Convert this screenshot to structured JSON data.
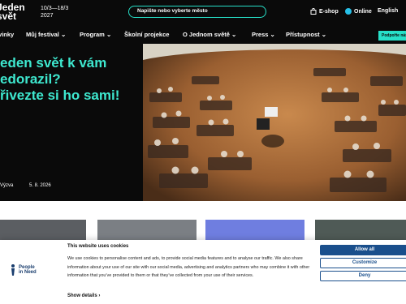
{
  "header": {
    "logo": [
      "Jeden",
      "svět"
    ],
    "dates": [
      "10/3—18/3",
      "2027"
    ],
    "search_placeholder": "Napište nebo vyberte město",
    "links": [
      {
        "label": "E-shop",
        "icon": "bag-icon"
      },
      {
        "label": "Online",
        "icon": "play-icon"
      },
      {
        "label": "English"
      }
    ]
  },
  "nav": {
    "items": [
      "vinky",
      "Můj festival",
      "Program",
      "Školní projekce",
      "O Jednom světě",
      "Press",
      "Přístupnost"
    ],
    "support_label": "Podpořte nás"
  },
  "hero": {
    "lines": [
      "eden svět k vám",
      "edorazil?",
      "řivezte si ho sami!"
    ],
    "meta_label": "Výzva",
    "meta_date": "5. 8. 2026"
  },
  "cookie": {
    "title": "This website uses cookies",
    "text": "We use cookies to personalise content and ads, to provide social media features and to analyse our traffic. We also share information about your use of our site with our social media, advertising and analytics partners who may combine it with other information that you’ve provided to them or that they’ve collected from your use of their services.",
    "show_details": "Show details",
    "buttons": {
      "allow_all": "Allow all",
      "customize": "Customize",
      "deny": "Deny"
    },
    "brand": [
      "People",
      "in Need"
    ]
  },
  "colors": {
    "accent": "#3ee8cf",
    "dark": "#0a0a0a",
    "cookie_blue": "#1a4f8c"
  }
}
